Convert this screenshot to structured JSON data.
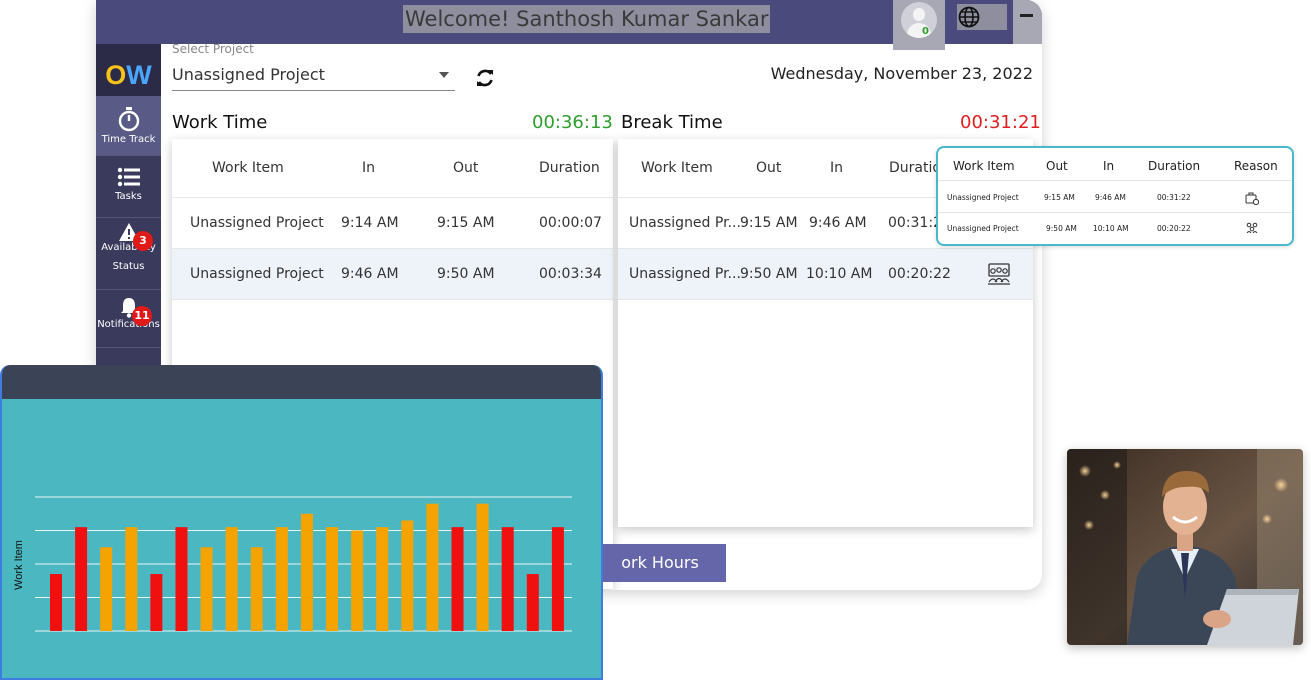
{
  "header": {
    "welcome": "Welcome! Santhosh Kumar Sankar",
    "avatar_badge": "0"
  },
  "logo": {
    "o": "O",
    "w": "W"
  },
  "sidebar": {
    "items": [
      {
        "label": "Time Track",
        "icon": "stopwatch-icon",
        "active": true
      },
      {
        "label": "Tasks",
        "icon": "list-icon"
      },
      {
        "label": "Availability",
        "sub": "Status",
        "icon": "warning-icon",
        "badge": "3"
      },
      {
        "label": "Notifications",
        "icon": "bell-icon",
        "badge": "11"
      }
    ]
  },
  "project": {
    "label": "Select Project",
    "value": "Unassigned Project"
  },
  "date": "Wednesday, November 23, 2022",
  "work": {
    "title": "Work Time",
    "timer": "00:36:13",
    "timer_color": "#2e9d2e",
    "headers": [
      "Work Item",
      "In",
      "Out",
      "Duration"
    ],
    "rows": [
      [
        "Unassigned Project",
        "9:14 AM",
        "9:15 AM",
        "00:00:07"
      ],
      [
        "Unassigned Project",
        "9:46 AM",
        "9:50 AM",
        "00:03:34"
      ]
    ]
  },
  "break": {
    "title": "Break Time",
    "timer": "00:31:21",
    "timer_color": "#e02020",
    "headers": [
      "Work Item",
      "Out",
      "In",
      "Duratio"
    ],
    "rows": [
      [
        "Unassigned Pr...",
        "9:15 AM",
        "9:46 AM",
        "00:31:2"
      ],
      [
        "Unassigned Pr...",
        "9:50 AM",
        "10:10 AM",
        "00:20:22"
      ]
    ]
  },
  "work_hours_button": "Work Hours",
  "work_hours_visible": "ork Hours",
  "popout": {
    "headers": [
      "Work Item",
      "Out",
      "In",
      "Duration",
      "Reason"
    ],
    "rows": [
      [
        "Unassigned Project",
        "9:15 AM",
        "9:46 AM",
        "00:31:22"
      ],
      [
        "Unassigned Project",
        "9:50 AM",
        "10:10 AM",
        "00:20:22"
      ]
    ],
    "reason_icons": [
      "briefcase-clock-icon",
      "meeting-icon"
    ]
  },
  "chart_data": {
    "type": "bar",
    "ylabel": "Work Item",
    "xlabel": "",
    "title": "",
    "grid": true,
    "categories": [
      "",
      "",
      "",
      "",
      "",
      "",
      "",
      "",
      "",
      "",
      "",
      "",
      "",
      "",
      "",
      "",
      "",
      "",
      "",
      "",
      ""
    ],
    "values": [
      1.7,
      3.1,
      2.5,
      3.1,
      1.7,
      3.1,
      2.5,
      3.1,
      2.5,
      3.1,
      3.5,
      3.1,
      3.0,
      3.1,
      3.3,
      3.8,
      3.1,
      3.8,
      3.1,
      1.7,
      3.1
    ],
    "colors": [
      "#f01010",
      "#f01010",
      "#f5a300",
      "#f5a300",
      "#f01010",
      "#f01010",
      "#f5a300",
      "#f5a300",
      "#f5a300",
      "#f5a300",
      "#f5a300",
      "#f5a300",
      "#f5a300",
      "#f5a300",
      "#f5a300",
      "#f5a300",
      "#f01010",
      "#f5a300",
      "#f01010",
      "#f01010",
      "#f01010"
    ],
    "ylim": [
      0,
      4
    ]
  },
  "colors": {
    "header": "#4a4a7c",
    "sidebar": "#3a3a5c",
    "chart_bg": "#4bb8c1",
    "button": "#6565a9"
  }
}
